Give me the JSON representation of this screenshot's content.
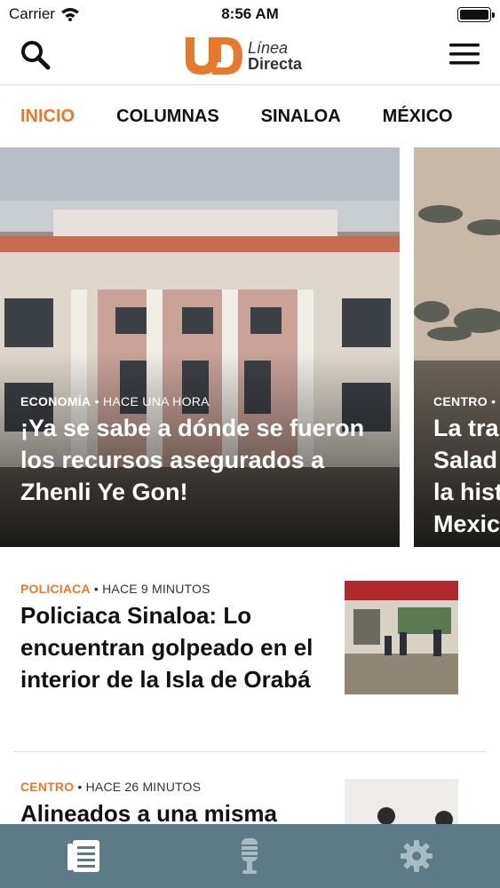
{
  "status_bar": {
    "carrier": "Carrier",
    "time": "8:56 AM",
    "battery_level": 1.0
  },
  "header": {
    "logo_line1": "Línea",
    "logo_line2": "Directa",
    "search_icon": "search-icon",
    "menu_icon": "hamburger-menu-icon"
  },
  "tabs": [
    {
      "label": "INICIO",
      "active": true
    },
    {
      "label": "COLUMNAS",
      "active": false
    },
    {
      "label": "SINALOA",
      "active": false
    },
    {
      "label": "MÉXICO",
      "active": false
    }
  ],
  "hero": [
    {
      "category": "ECONOMÍA",
      "time": "HACE UNA HORA",
      "title": "¡Ya se sabe a dónde se fueron los recursos asegurados a Zhenli Ye Gon!"
    },
    {
      "category": "CENTRO",
      "time": "",
      "title_lines": [
        "La tra",
        "Salad",
        "la hist",
        "Mexic"
      ]
    }
  ],
  "articles": [
    {
      "category": "POLICIACA",
      "time": "HACE 9 MINUTOS",
      "title": "Policiaca Sinaloa: Lo encuentran golpeado en el interior de la Isla de Orabá"
    },
    {
      "category": "CENTRO",
      "time": "HACE 26 MINUTOS",
      "title": "Alineados a una misma"
    }
  ],
  "bottom_nav": [
    {
      "icon": "news-icon",
      "active": true
    },
    {
      "icon": "microphone-icon",
      "active": false
    },
    {
      "icon": "gear-icon",
      "active": false
    }
  ],
  "colors": {
    "accent": "#e8782a",
    "bottom_bar": "#5d7b87",
    "inactive_icon": "#a9bcc4"
  }
}
